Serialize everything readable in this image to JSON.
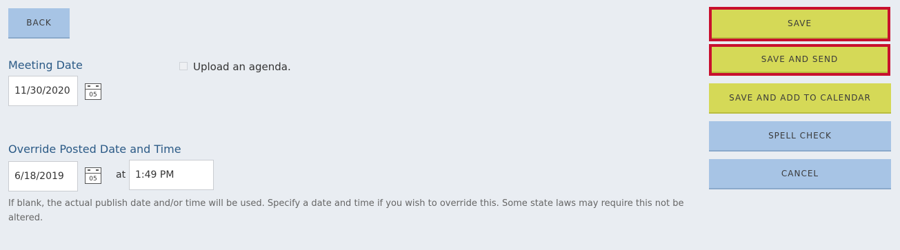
{
  "toolbar": {
    "back_label": "BACK"
  },
  "meeting_date": {
    "label": "Meeting Date",
    "value": "11/30/2020",
    "calendar_day": "05"
  },
  "agenda": {
    "label": "Upload an agenda.",
    "checked": false
  },
  "override": {
    "label": "Override Posted Date and Time",
    "date_value": "6/18/2019",
    "calendar_day": "05",
    "at_label": "at",
    "time_value": "1:49 PM",
    "help_text_line1": "If blank, the actual publish date and/or time will be used. Specify a date and time if you wish to override this. Some state laws may require this not be",
    "help_text_line2": "altered."
  },
  "actions": {
    "save": "SAVE",
    "save_and_send": "SAVE AND SEND",
    "save_and_add_to_calendar": "SAVE AND ADD TO CALENDAR",
    "spell_check": "SPELL CHECK",
    "cancel": "CANCEL"
  },
  "colors": {
    "background": "#e9edf2",
    "button_blue": "#a7c4e5",
    "button_yellow": "#d5d957",
    "highlight_outline": "#c8102e",
    "label_blue": "#2b5a86"
  }
}
